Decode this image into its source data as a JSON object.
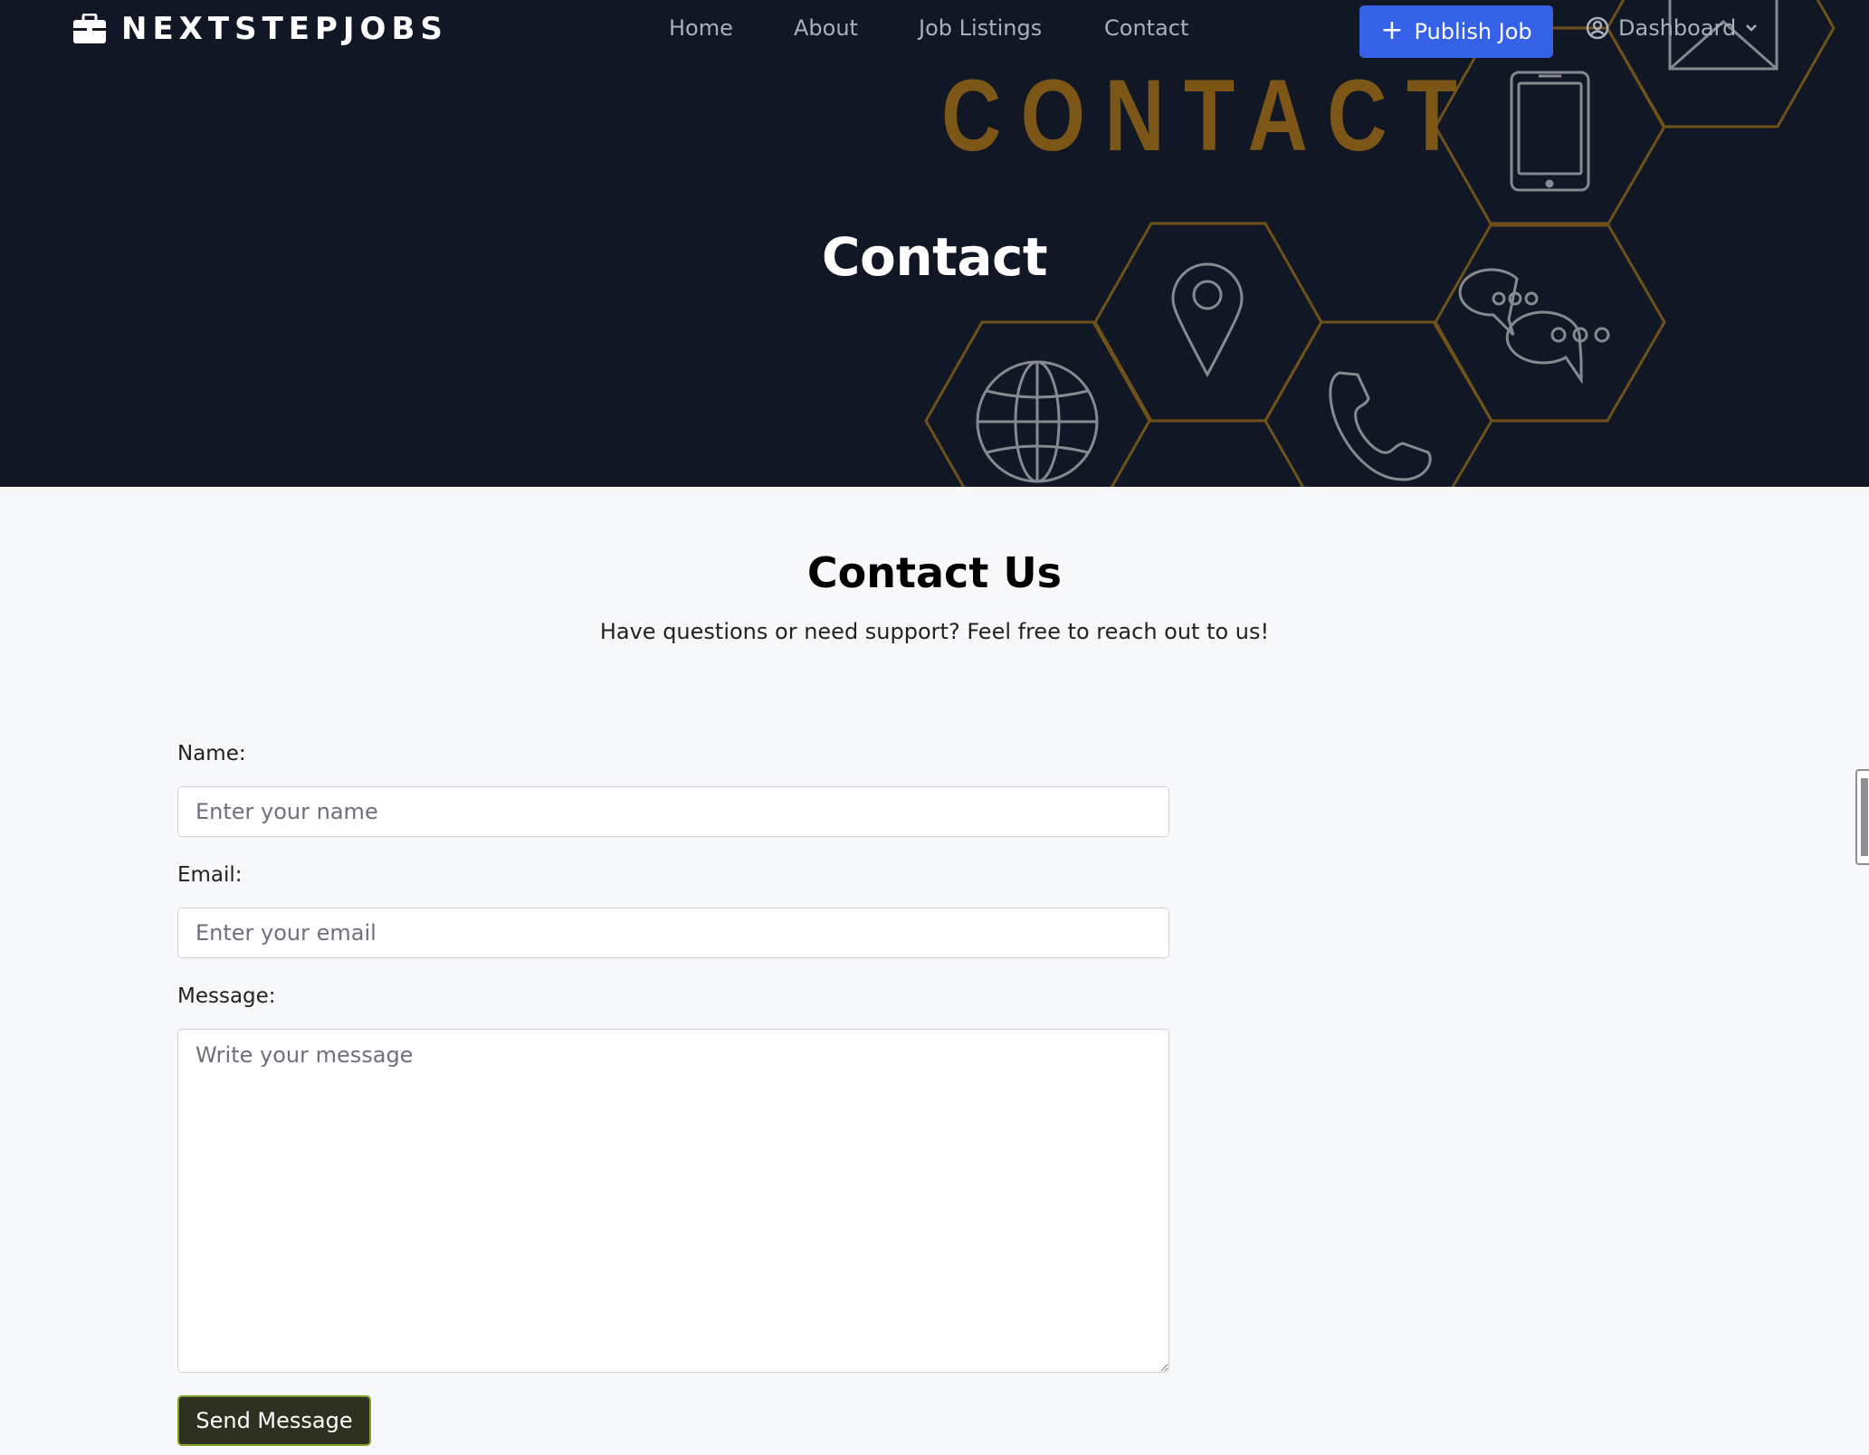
{
  "brand": {
    "name": "NEXTSTEPJOBS",
    "icon": "briefcase-icon"
  },
  "nav": {
    "links": [
      "Home",
      "About",
      "Job Listings",
      "Contact"
    ],
    "publish_label": "Publish Job",
    "publish_icon": "plus-icon",
    "dashboard_label": "Dashboard",
    "dashboard_icons": [
      "user-circle-icon",
      "chevron-down-icon"
    ]
  },
  "hero": {
    "banner_word": "CONTACT",
    "title": "Contact",
    "art_icons": [
      "tablet-icon",
      "envelope-icon",
      "location-pin-icon",
      "chat-bubbles-icon",
      "globe-icon",
      "phone-icon"
    ]
  },
  "contact": {
    "title": "Contact Us",
    "subtitle": "Have questions or need support? Feel free to reach out to us!",
    "name_label": "Name:",
    "name_placeholder": "Enter your name",
    "email_label": "Email:",
    "email_placeholder": "Enter your email",
    "message_label": "Message:",
    "message_placeholder": "Write your message",
    "send_label": "Send Message"
  },
  "colors": {
    "hero_bg": "#111724",
    "accent_gold": "#7c5616",
    "publish_blue": "#3461e6",
    "send_bg": "#2f3120"
  }
}
